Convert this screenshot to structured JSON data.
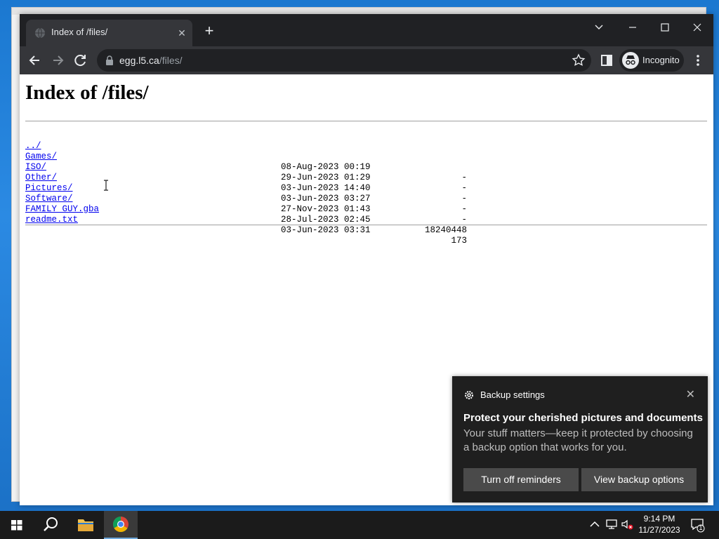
{
  "browser": {
    "tab_title": "Index of /files/",
    "url_host": "egg.l5.ca",
    "url_path": "/files/",
    "incognito_label": "Incognito"
  },
  "page": {
    "heading": "Index of /files/",
    "entries": [
      {
        "name": "../",
        "date": "",
        "size": ""
      },
      {
        "name": "Games/",
        "date": "08-Aug-2023 00:19",
        "size": "-"
      },
      {
        "name": "ISO/",
        "date": "29-Jun-2023 01:29",
        "size": "-"
      },
      {
        "name": "Other/",
        "date": "03-Jun-2023 14:40",
        "size": "-"
      },
      {
        "name": "Pictures/",
        "date": "03-Jun-2023 03:27",
        "size": "-"
      },
      {
        "name": "Software/",
        "date": "27-Nov-2023 01:43",
        "size": "-"
      },
      {
        "name": "FAMILY_GUY.gba",
        "date": "28-Jul-2023 02:45",
        "size": "18240448"
      },
      {
        "name": "readme.txt",
        "date": "03-Jun-2023 03:31",
        "size": "173"
      }
    ]
  },
  "toast": {
    "app_name": "Backup settings",
    "title": "Protect your cherished pictures and documents",
    "body": "Your stuff matters—keep it protected by choosing a backup option that works for you.",
    "button_left": "Turn off reminders",
    "button_right": "View backup options"
  },
  "taskbar": {
    "time": "9:14 PM",
    "date": "11/27/2023",
    "notification_count": "1"
  },
  "colors": {
    "link": "#0000ee",
    "chrome_dark": "#202124",
    "toast_bg": "#1f1f1f"
  },
  "icons": [
    "globe-icon",
    "close-icon",
    "plus-icon",
    "chevron-down-icon",
    "minimize-icon",
    "maximize-icon",
    "back-icon",
    "forward-icon",
    "reload-icon",
    "lock-icon",
    "star-icon",
    "side-panel-icon",
    "incognito-icon",
    "menu-icon",
    "gear-icon",
    "windows-start-icon",
    "search-icon",
    "file-explorer-icon",
    "chrome-icon",
    "chevron-up-icon",
    "network-icon",
    "volume-muted-icon",
    "notification-icon"
  ]
}
